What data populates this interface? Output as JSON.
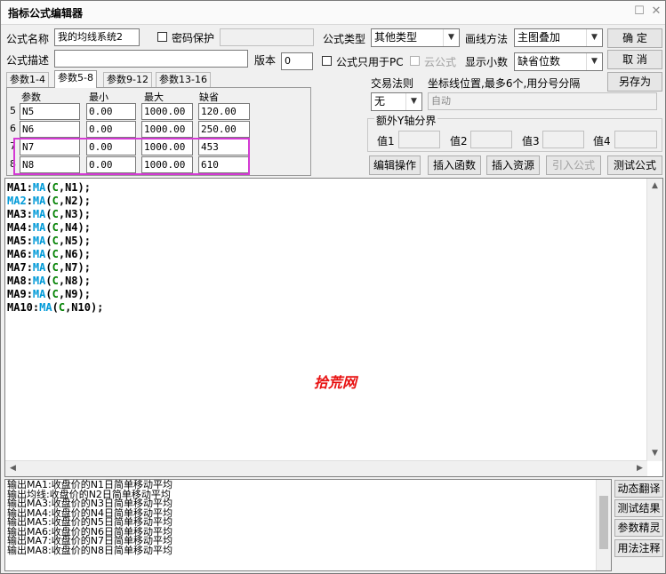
{
  "window": {
    "title": "指标公式编辑器"
  },
  "form": {
    "name_label": "公式名称",
    "name_value": "我的均线系统2",
    "password_label": "密码保护",
    "type_label": "公式类型",
    "type_value": "其他类型",
    "draw_label": "画线方法",
    "draw_value": "主图叠加",
    "desc_label": "公式描述",
    "desc_value": "",
    "version_label": "版本",
    "version_value": "0",
    "pc_only_label": "公式只用于PC",
    "cloud_label": "云公式",
    "decimals_label": "显示小数",
    "decimals_value": "缺省位数",
    "trade_rule_label": "交易法则",
    "trade_rule_value": "无",
    "coord_label": "坐标线位置,最多6个,用分号分隔",
    "coord_value": "自动",
    "yaxis_label": "额外Y轴分界",
    "y1_label": "值1",
    "y2_label": "值2",
    "y3_label": "值3",
    "y4_label": "值4"
  },
  "buttons": {
    "ok": "确  定",
    "cancel": "取  消",
    "save_as": "另存为",
    "edit_ops": "编辑操作",
    "insert_func": "插入函数",
    "insert_res": "插入资源",
    "import_formula": "引入公式",
    "test_formula": "测试公式"
  },
  "tabs": [
    "参数1-4",
    "参数5-8",
    "参数9-12",
    "参数13-16"
  ],
  "active_tab": "参数5-8",
  "params": {
    "headers": [
      "参数",
      "最小",
      "最大",
      "缺省"
    ],
    "rows": [
      {
        "num": "5",
        "name": "N5",
        "min": "0.00",
        "max": "1000.00",
        "def": "120.00"
      },
      {
        "num": "6",
        "name": "N6",
        "min": "0.00",
        "max": "1000.00",
        "def": "250.00"
      },
      {
        "num": "7",
        "name": "N7",
        "min": "0.00",
        "max": "1000.00",
        "def": "453"
      },
      {
        "num": "8",
        "name": "N8",
        "min": "0.00",
        "max": "1000.00",
        "def": "610"
      }
    ]
  },
  "code_lines": [
    {
      "out": "MA1",
      "fn": "MA",
      "var": "C",
      "arg": "N1"
    },
    {
      "out": "MA2",
      "fn": "MA",
      "var": "C",
      "arg": "N2"
    },
    {
      "out": "MA3",
      "fn": "MA",
      "var": "C",
      "arg": "N3"
    },
    {
      "out": "MA4",
      "fn": "MA",
      "var": "C",
      "arg": "N4"
    },
    {
      "out": "MA5",
      "fn": "MA",
      "var": "C",
      "arg": "N5"
    },
    {
      "out": "MA6",
      "fn": "MA",
      "var": "C",
      "arg": "N6"
    },
    {
      "out": "MA7",
      "fn": "MA",
      "var": "C",
      "arg": "N7"
    },
    {
      "out": "MA8",
      "fn": "MA",
      "var": "C",
      "arg": "N8"
    },
    {
      "out": "MA9",
      "fn": "MA",
      "var": "C",
      "arg": "N9"
    },
    {
      "out": "MA10",
      "fn": "MA",
      "var": "C",
      "arg": "N10"
    }
  ],
  "watermark": "拾荒网",
  "output_lines": [
    "输出MA1:收盘价的N1日简单移动平均",
    "输出均线:收盘价的N2日简单移动平均",
    "输出MA3:收盘价的N3日简单移动平均",
    "输出MA4:收盘价的N4日简单移动平均",
    "输出MA5:收盘价的N5日简单移动平均",
    "输出MA6:收盘价的N6日简单移动平均",
    "输出MA7:收盘价的N7日简单移动平均",
    "输出MA8:收盘价的N8日简单移动平均"
  ],
  "side_buttons": [
    "动态翻译",
    "测试结果",
    "参数精灵",
    "用法注释"
  ],
  "colors": {
    "function": "#009ad8",
    "variable": "#008000",
    "watermark": "#e81010",
    "highlight": "#d43ad4"
  }
}
